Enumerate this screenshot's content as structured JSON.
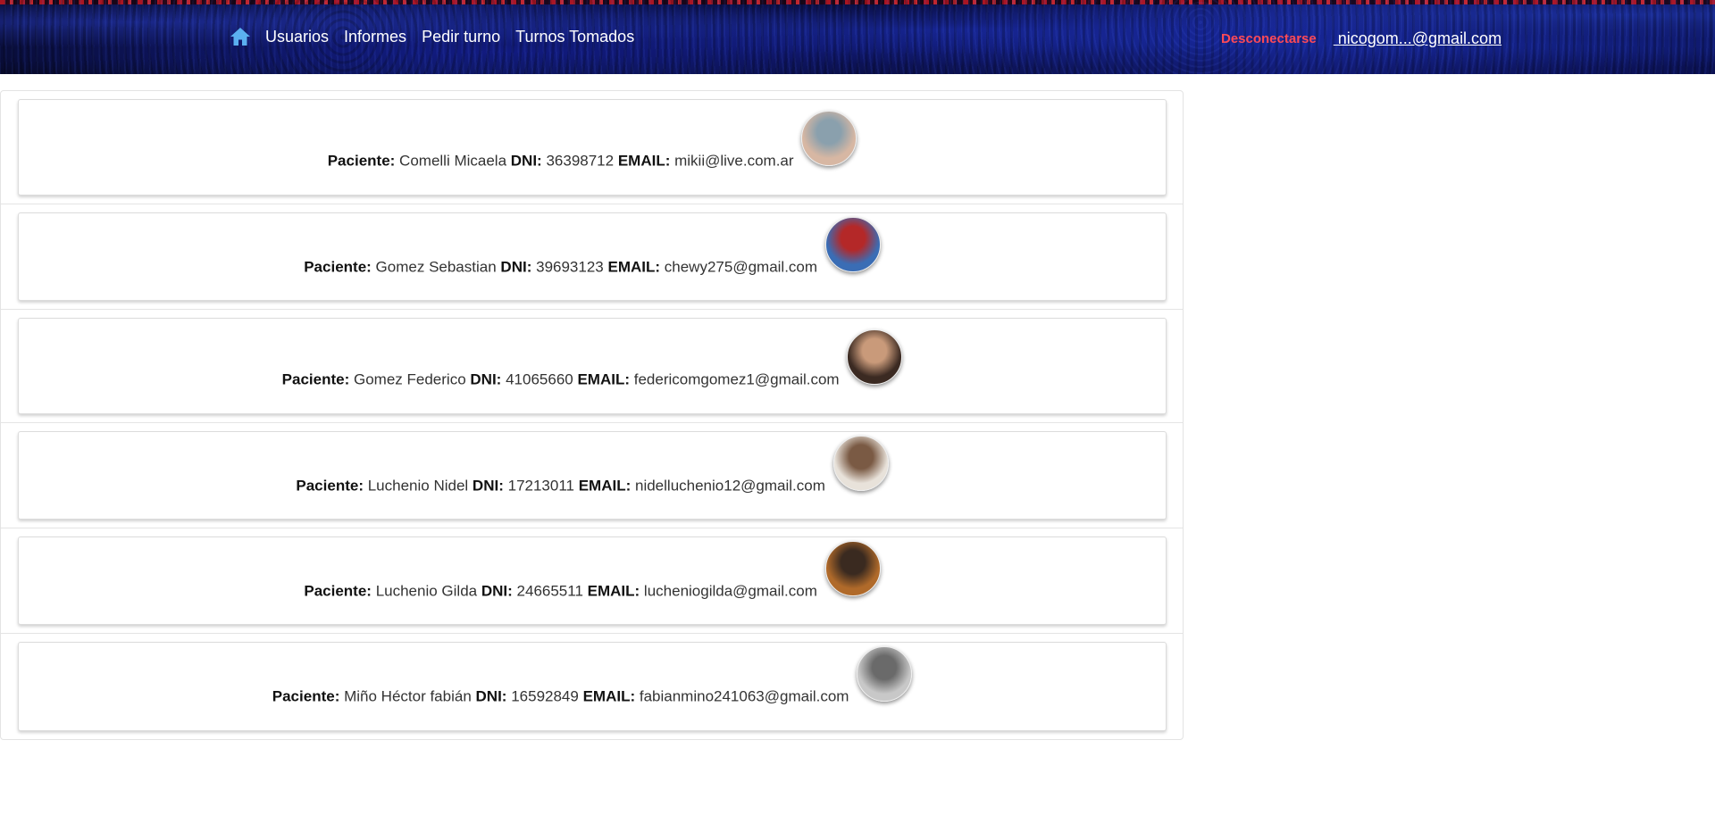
{
  "navbar": {
    "home_icon": "home-icon",
    "links": [
      {
        "label": "Usuarios"
      },
      {
        "label": "Informes"
      },
      {
        "label": "Pedir turno"
      },
      {
        "label": "Turnos Tomados"
      }
    ],
    "logout_label": "Desconectarse",
    "user_label": " nicogom...@gmail.com",
    "colors": {
      "logout": "#ff4a55",
      "home_icon": "#5bb0f0",
      "link": "#ffffff"
    }
  },
  "labels": {
    "patient": "Paciente:",
    "dni": "DNI:",
    "email": "EMAIL:"
  },
  "patients": [
    {
      "name": "Comelli Micaela",
      "dni": "36398712",
      "email": "mikii@live.com.ar",
      "avatar_colors": [
        "#d7b7a3",
        "#8aa0ad"
      ]
    },
    {
      "name": "Gomez Sebastian",
      "dni": "39693123",
      "email": "chewy275@gmail.com",
      "avatar_colors": [
        "#3a6db5",
        "#b42828"
      ]
    },
    {
      "name": "Gomez Federico",
      "dni": "41065660",
      "email": "federicomgomez1@gmail.com",
      "avatar_colors": [
        "#3b2a22",
        "#c99a7a"
      ]
    },
    {
      "name": "Luchenio Nidel",
      "dni": "17213011",
      "email": "nidelluchenio12@gmail.com",
      "avatar_colors": [
        "#e8e2da",
        "#7a5a44"
      ]
    },
    {
      "name": "Luchenio Gilda",
      "dni": "24665511",
      "email": "lucheniogilda@gmail.com",
      "avatar_colors": [
        "#b06a2a",
        "#3a2a20"
      ]
    },
    {
      "name": "Miño Héctor fabián",
      "dni": "16592849",
      "email": "fabianmino241063@gmail.com",
      "avatar_colors": [
        "#c8c8c8",
        "#6a6a6a"
      ]
    }
  ]
}
